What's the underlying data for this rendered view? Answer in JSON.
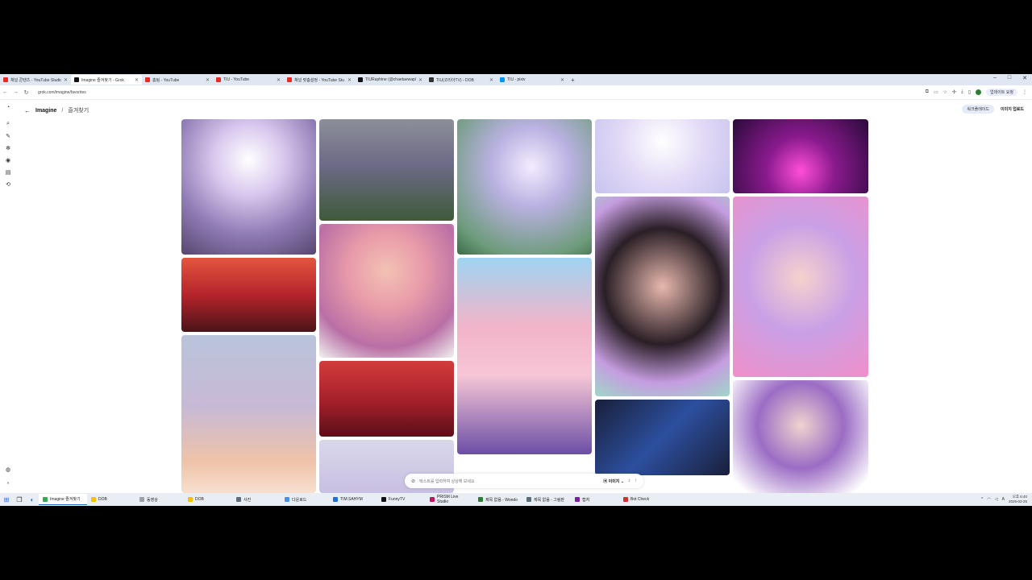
{
  "browser": {
    "tabs": [
      {
        "title": "채널 콘텐츠 - YouTube Studio",
        "color": "#e52d27"
      },
      {
        "title": "Imagine 즐겨찾기 - Grok",
        "color": "#111111",
        "active": true
      },
      {
        "title": "홈팀 - YouTube",
        "color": "#e52d27"
      },
      {
        "title": "TIU - YouTube",
        "color": "#e52d27"
      },
      {
        "title": "채널 맞춤설정 - YouTube Stu",
        "color": "#e52d27"
      },
      {
        "title": "TIURaphine (@chaetaewap/t)",
        "color": "#111111"
      },
      {
        "title": "TIU(코리아TV) - DOB",
        "color": "#333333"
      },
      {
        "title": "TIU - pixiv",
        "color": "#0096fa"
      }
    ],
    "new_tab": "+",
    "url": "grok.com/imagine/favorites",
    "profile": "업데이트 요청"
  },
  "page": {
    "back_icon": "←",
    "title": "Imagine",
    "separator": "/",
    "subtitle": "즐겨찾기",
    "header_button": "워크플레이드",
    "upload_button": "이미지 업로드"
  },
  "prompt": {
    "placeholder": "텍스트를 입력하여 상상해 보세요",
    "mode": "이미지"
  },
  "taskbar": {
    "items": [
      {
        "title": "Imagine 즐겨찾기",
        "color": "#34a853",
        "active": true
      },
      {
        "title": "DOB",
        "color": "#f4c20d"
      },
      {
        "title": "동영상",
        "color": "#9aa0a6"
      },
      {
        "title": "DOB",
        "color": "#f4c20d"
      },
      {
        "title": "사진",
        "color": "#5f6c7b"
      },
      {
        "title": "다운로드",
        "color": "#4a8fe7"
      },
      {
        "title": "TIM.SAHYM",
        "color": "#1e6fd9"
      },
      {
        "title": "FunnyTV",
        "color": "#111111"
      },
      {
        "title": "PRISM Live Studio",
        "color": "#c2185b"
      },
      {
        "title": "제목 없음 - Wondo",
        "color": "#2e7d32"
      },
      {
        "title": "제목 없음 - 그림판",
        "color": "#546e7a"
      },
      {
        "title": "캡처",
        "color": "#7b1fa2"
      },
      {
        "title": "Bot Check",
        "color": "#d32f2f"
      }
    ],
    "time": "오후 6:40",
    "date": "2026-02-25"
  }
}
